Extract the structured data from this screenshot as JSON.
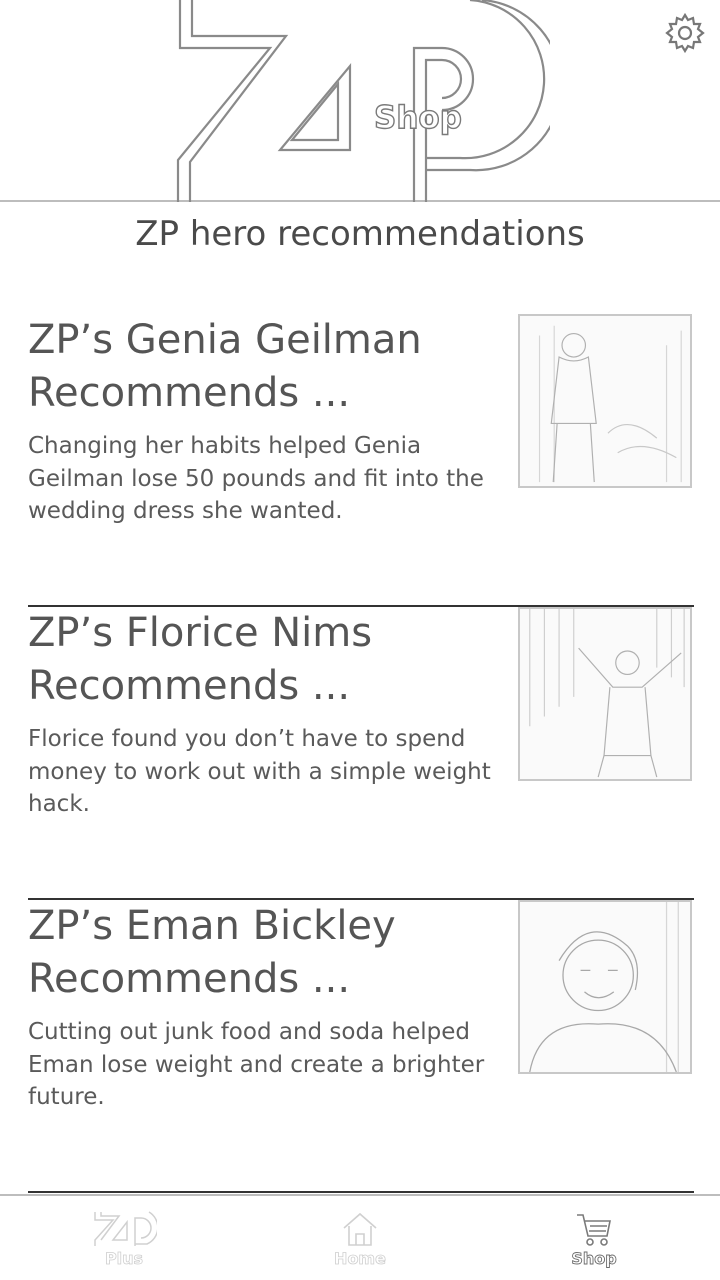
{
  "header": {
    "logo_text": "Shop"
  },
  "page_title": "ZP hero recommendations",
  "cards": [
    {
      "title": "ZP’s Genia Geilman\nRecommends ...",
      "description": "Changing her habits helped Genia Geilman lose 50 pounds and fit into the wedding dress she wanted."
    },
    {
      "title": "ZP’s Florice Nims\nRecommends ...",
      "description": "Florice found you don’t have to spend money to work out with a simple weight hack."
    },
    {
      "title": "ZP’s Eman Bickley\nRecommends ...",
      "description": "Cutting out junk food and soda helped Eman lose weight and create a brighter future."
    }
  ],
  "bottom_nav": {
    "items": [
      {
        "label": "Plus",
        "icon": "zp-logo-icon"
      },
      {
        "label": "Home",
        "icon": "home-icon"
      },
      {
        "label": "Shop",
        "icon": "cart-icon",
        "active": true
      }
    ]
  }
}
